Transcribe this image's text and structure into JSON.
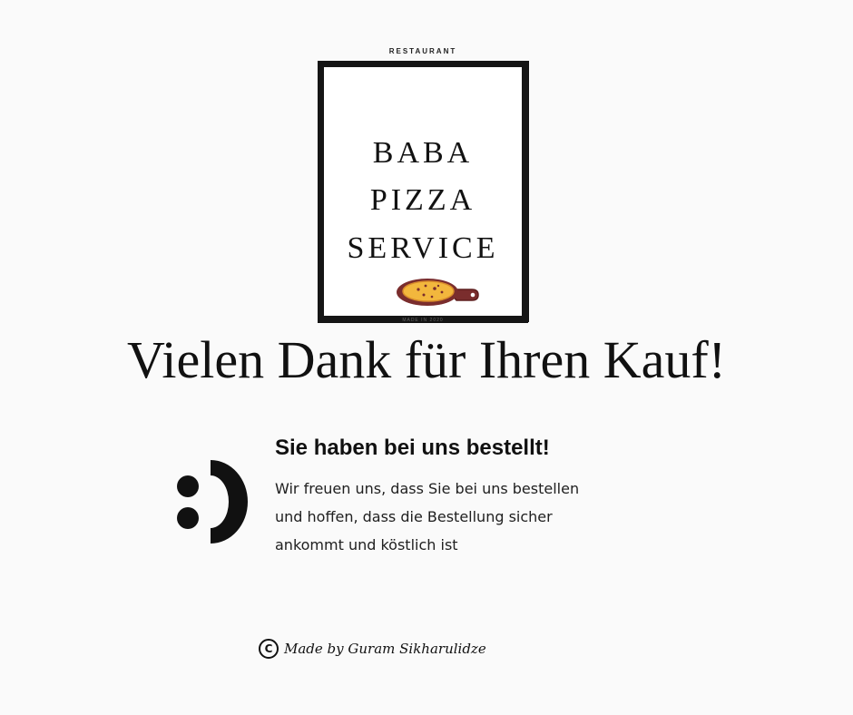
{
  "logo": {
    "kicker": "RESTAURANT",
    "lines": [
      "BABA",
      "PIZZA",
      "SERVICE"
    ],
    "illustration": "pizza-peel-icon",
    "footer": "MADE IN 2020"
  },
  "headline": "Vielen Dank für Ihren Kauf!",
  "message": {
    "title": "Sie haben bei uns bestellt!",
    "body_lines": [
      "Wir freuen uns, dass Sie bei uns bestellen",
      "und hoffen, dass die Bestellung sicher",
      "ankommt und köstlich ist"
    ],
    "emoticon": "smiley-icon"
  },
  "footer": {
    "symbol": "C",
    "text": "Made by Guram Sikharulidze"
  },
  "colors": {
    "background": "#fafafa",
    "text": "#111111",
    "pizza_crust": "#7a2d2d",
    "pizza_cheese": "#f2b73d"
  }
}
